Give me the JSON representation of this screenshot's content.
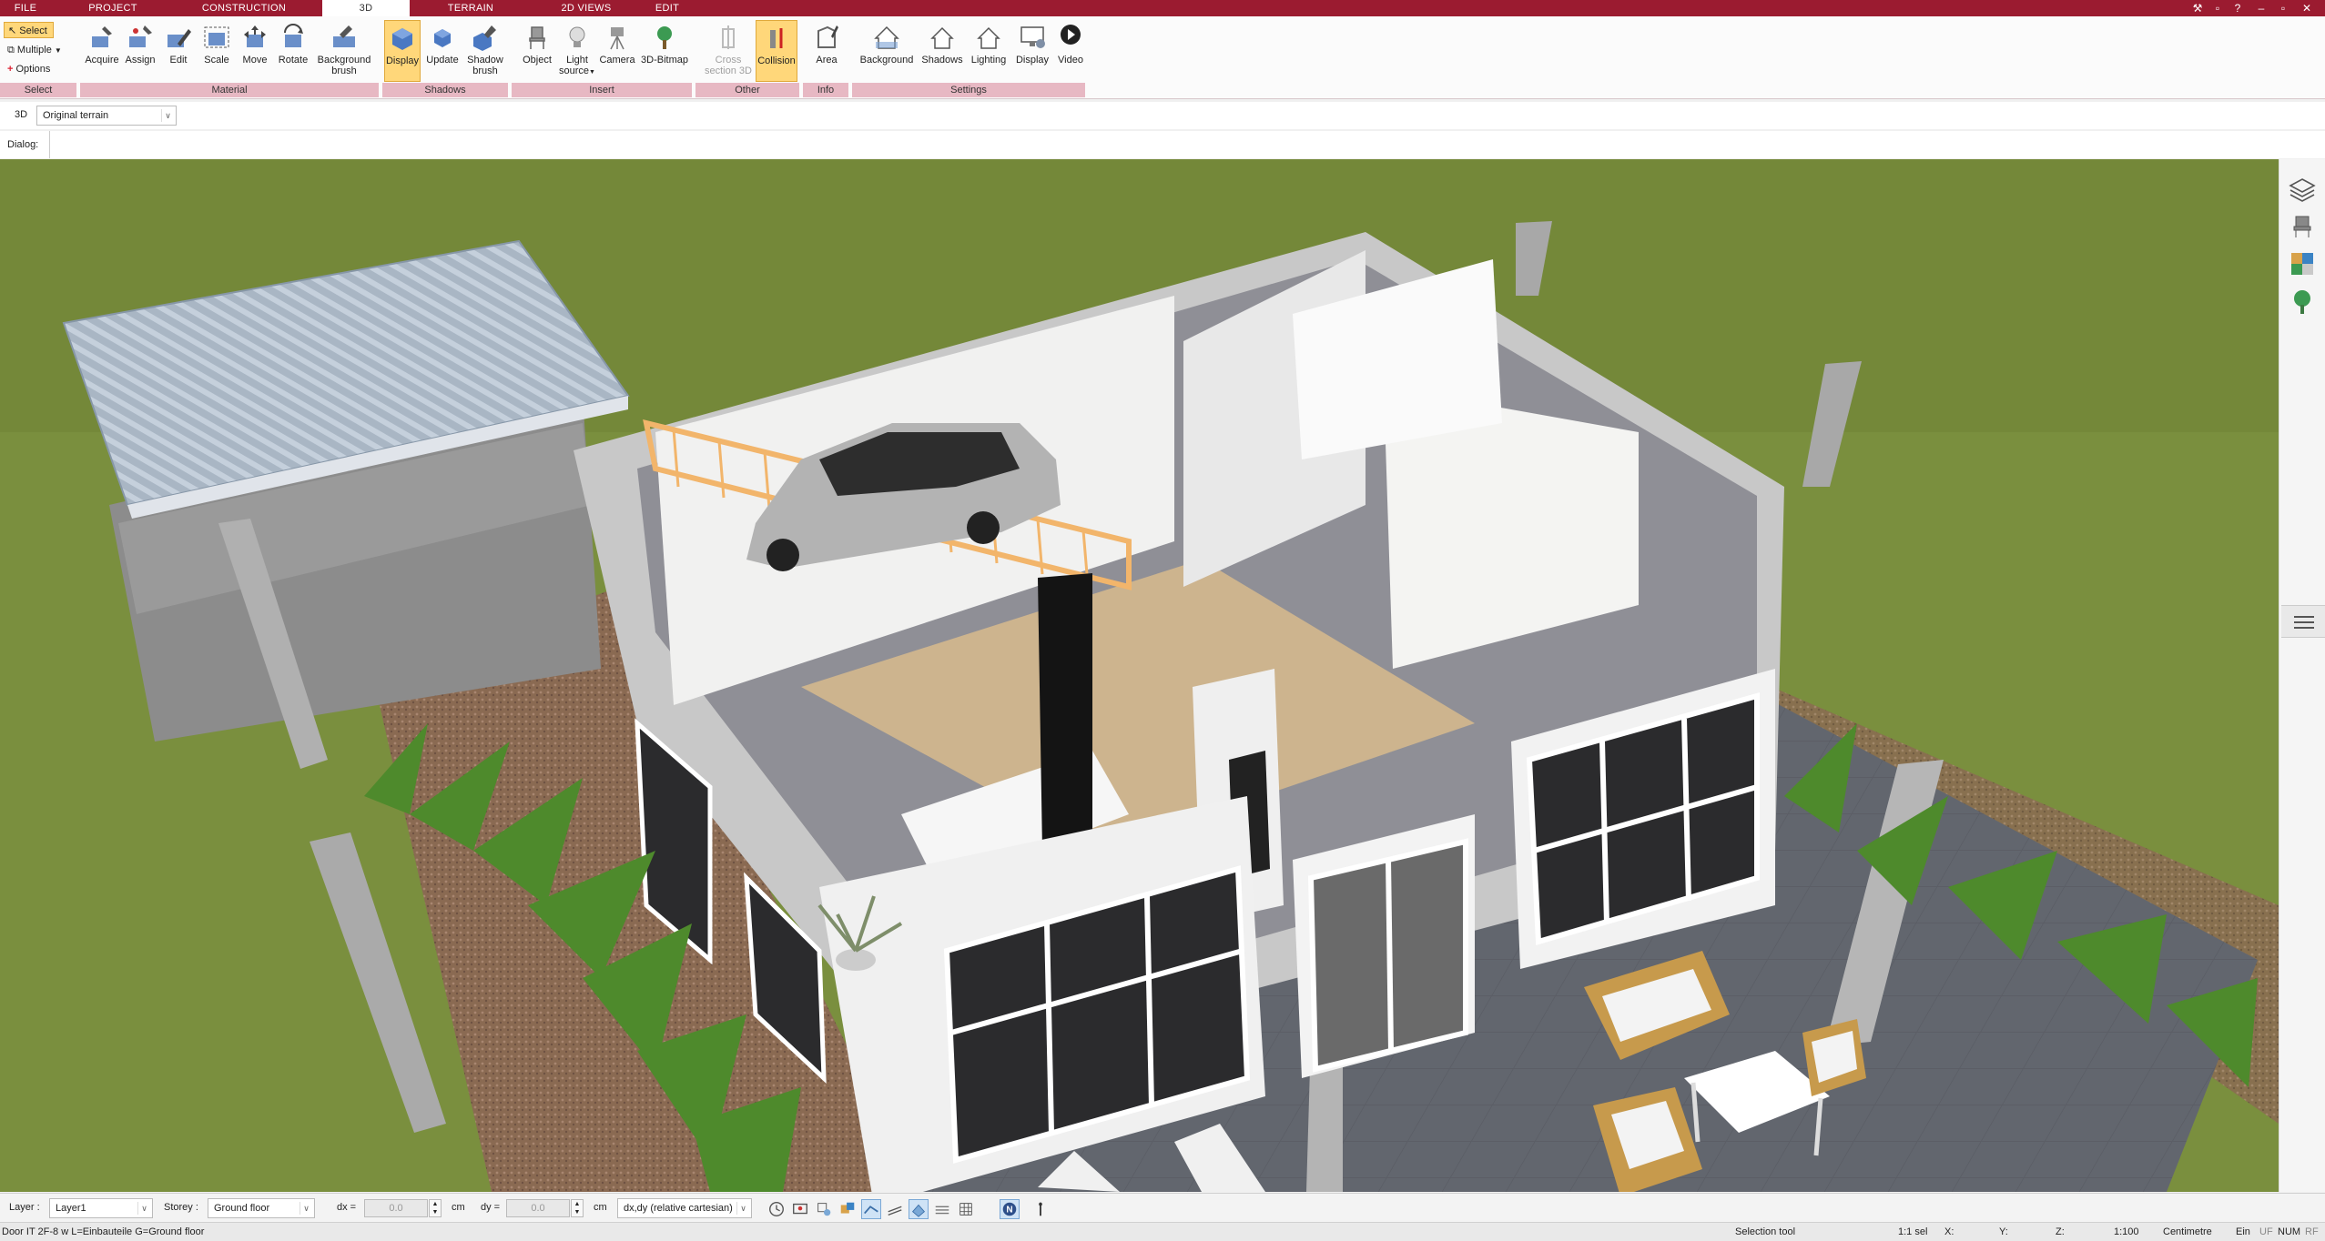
{
  "tabs": [
    {
      "label": "FILE",
      "active": false
    },
    {
      "label": "PROJECT",
      "active": false
    },
    {
      "label": "CONSTRUCTION",
      "active": false
    },
    {
      "label": "3D",
      "active": true
    },
    {
      "label": "TERRAIN",
      "active": false
    },
    {
      "label": "2D VIEWS",
      "active": false
    },
    {
      "label": "EDIT",
      "active": false
    }
  ],
  "ribbon": {
    "select_group": {
      "select": "Select",
      "multiple": "Multiple",
      "options": "Options",
      "label": "Select"
    },
    "material_group": {
      "label": "Material",
      "buttons": [
        "Acquire",
        "Assign",
        "Edit",
        "Scale",
        "Move",
        "Rotate"
      ],
      "bg_brush_line1": "Background",
      "bg_brush_line2": "brush"
    },
    "shadows_group": {
      "label": "Shadows",
      "display": "Display",
      "update": "Update",
      "shadow_brush_line1": "Shadow",
      "shadow_brush_line2": "brush"
    },
    "insert_group": {
      "label": "Insert",
      "object": "Object",
      "light_line1": "Light",
      "light_line2": "source",
      "camera": "Camera",
      "bitmap": "3D-Bitmap"
    },
    "other_group": {
      "label": "Other",
      "cross_line1": "Cross",
      "cross_line2": "section 3D",
      "collision": "Collision"
    },
    "info_group": {
      "label": "Info",
      "area": "Area"
    },
    "settings_group": {
      "label": "Settings",
      "buttons": [
        "Background",
        "Shadows",
        "Lighting",
        "Display",
        "Video"
      ]
    }
  },
  "viewrow": {
    "view_label": "3D",
    "terrain_select": "Original terrain"
  },
  "dialogrow": {
    "dialog_label": "Dialog:"
  },
  "statusbar": {
    "layer_label": "Layer :",
    "layer_value": "Layer1",
    "storey_label": "Storey :",
    "storey_value": "Ground floor",
    "dx_label": "dx =",
    "dx_value": "0.0",
    "dx_unit": "cm",
    "dy_label": "dy =",
    "dy_value": "0.0",
    "dy_unit": "cm",
    "coord_mode": "dx,dy (relative cartesian)"
  },
  "status": {
    "info": "Door IT 2F-8 w L=Einbauteile G=Ground floor",
    "tool": "Selection tool",
    "sel": "1:1 sel",
    "x_label": "X:",
    "y_label": "Y:",
    "z_label": "Z:",
    "scale": "1:100",
    "unit": "Centimetre",
    "ein": "Ein",
    "uf": "UF",
    "num": "NUM",
    "rf": "RF"
  },
  "colors": {
    "accent": "#9b1b30",
    "ribbon_label": "#e7b8c3",
    "active_button": "#ffd77a",
    "grass": "#7c8f40"
  }
}
